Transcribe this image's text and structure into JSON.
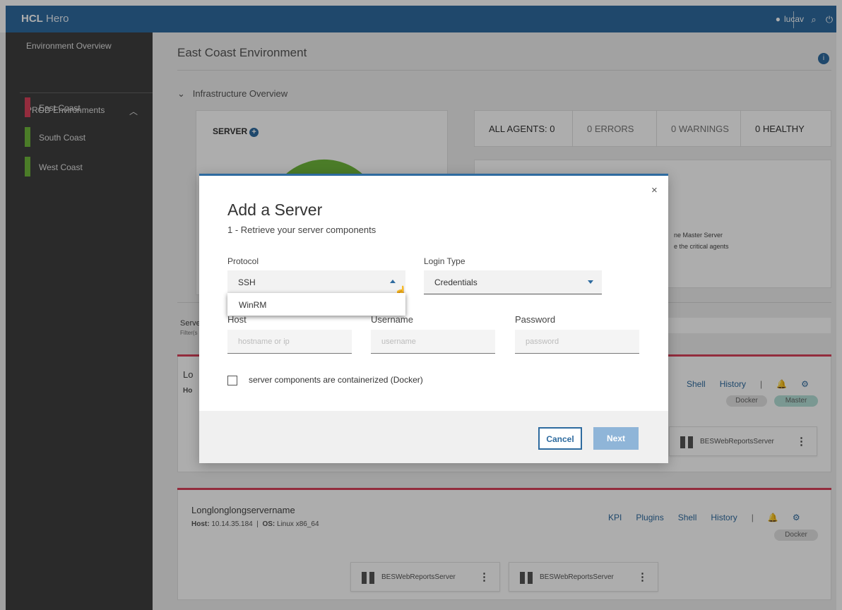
{
  "header": {
    "brand_bold": "HCL",
    "brand_rest": "Hero",
    "user": "lucav",
    "bg": "#2e6b9f"
  },
  "sidebar": {
    "overview": "Environment Overview",
    "section": "PROD Environments",
    "items": [
      {
        "label": "East Coast",
        "color": "#d9415b"
      },
      {
        "label": "South Coast",
        "color": "#6fb73b"
      },
      {
        "label": "West Coast",
        "color": "#6fb73b"
      }
    ]
  },
  "page": {
    "title": "East Coast Environment",
    "infra": "Infrastructure Overview",
    "server_label": "SERVER"
  },
  "stats": {
    "all": "ALL AGENTS: 0",
    "errors": "0 ERRORS",
    "warnings": "0 WARNINGS",
    "healthy": "0 HEALTHY"
  },
  "status_text": [
    "ne Master Server",
    "e the critical agents"
  ],
  "servers_heading": "Serve",
  "servers_filter": "Filter(s",
  "server1": {
    "partial_name": "Lo",
    "partial_host": "Ho",
    "links": [
      "Shell",
      "History"
    ],
    "badges": [
      "Docker",
      "Master"
    ],
    "component": "BESWebReportsServer"
  },
  "server2": {
    "name": "Longlonglongservername",
    "host_label": "Host:",
    "host": "10.14.35.184",
    "os_label": "OS:",
    "os": "Linux x86_64",
    "links": [
      "KPI",
      "Plugins",
      "Shell",
      "History"
    ],
    "badges": [
      "Docker"
    ],
    "components": [
      "BESWebReportsServer",
      "BESWebReportsServer"
    ]
  },
  "modal": {
    "title": "Add a Server",
    "subtitle": "1 - Retrieve your server components",
    "protocol_label": "Protocol",
    "protocol_value": "SSH",
    "protocol_option": "WinRM",
    "login_label": "Login Type",
    "login_value": "Credentials",
    "host_label": "Host",
    "username_label": "Username",
    "password_label": "Password",
    "host_ph": "hostname or ip",
    "username_ph": "username",
    "password_ph": "password",
    "docker_label": "server components are containerized (Docker)",
    "cancel": "Cancel",
    "next": "Next",
    "close": "×"
  }
}
